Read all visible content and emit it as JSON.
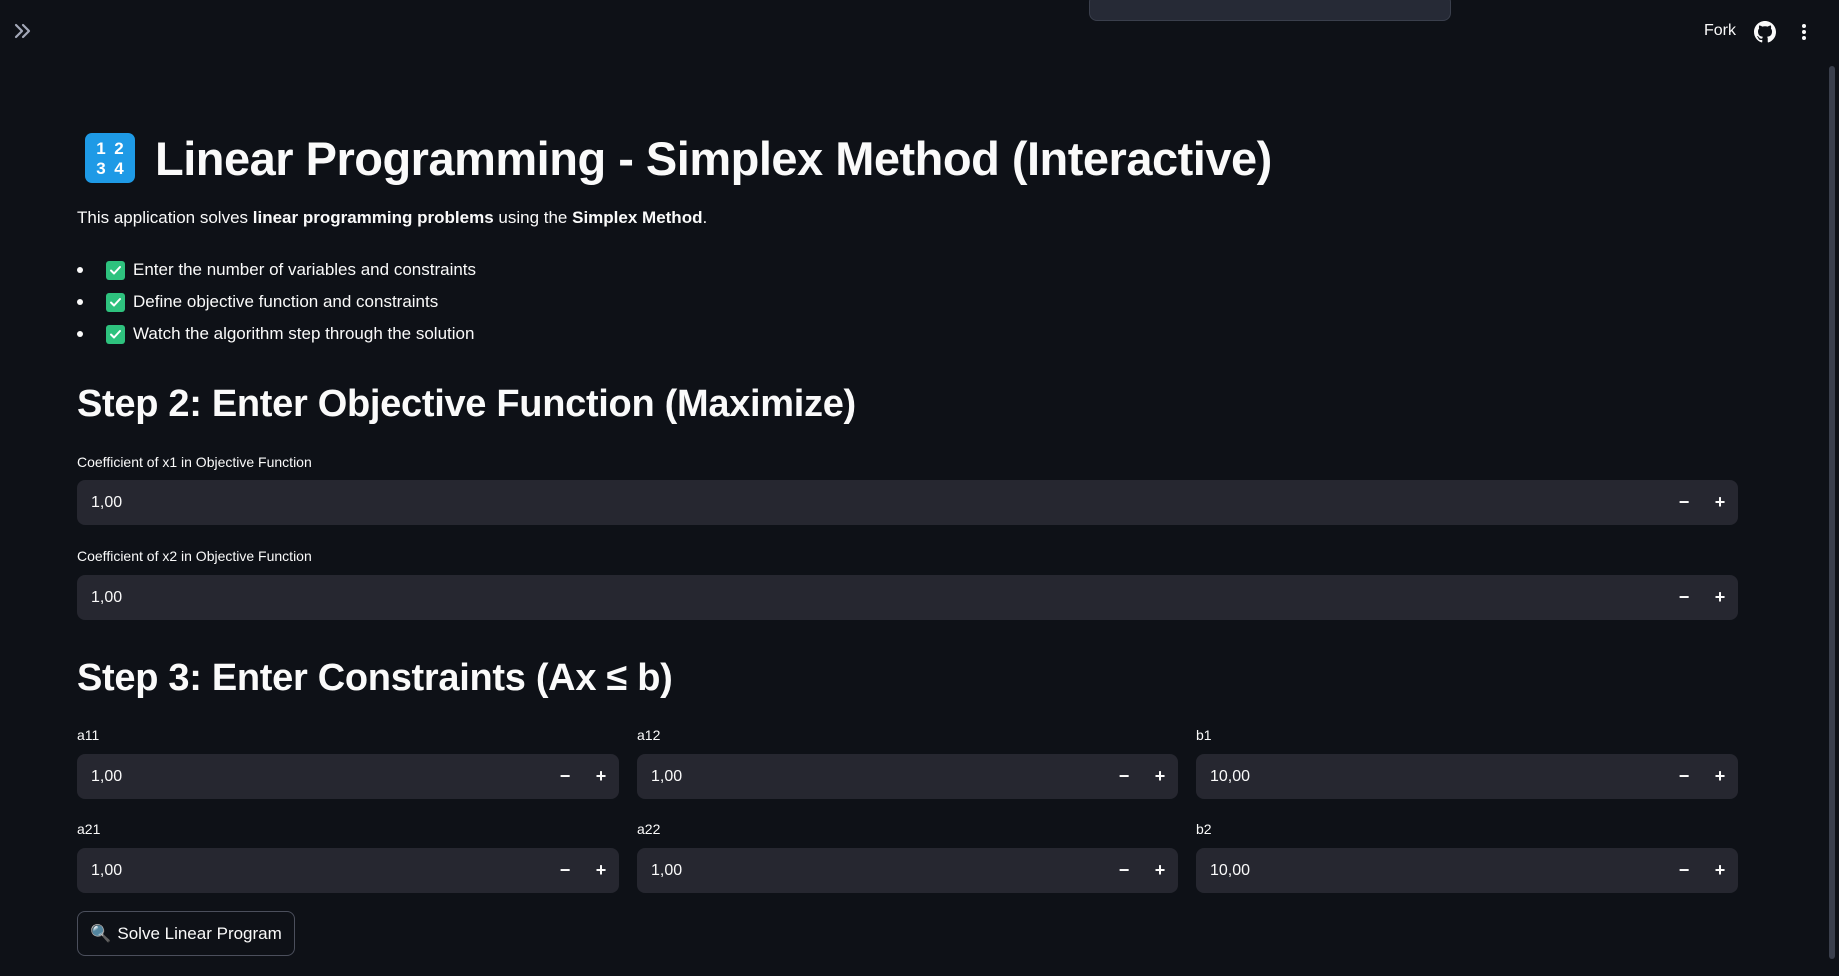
{
  "header": {
    "fork_label": "Fork",
    "icons": [
      "double-chevron-right-icon",
      "github-icon",
      "kebab-menu-icon"
    ]
  },
  "title": {
    "emoji_digits": [
      "1",
      "2",
      "3",
      "4"
    ],
    "text": "Linear Programming - Simplex Method (Interactive)"
  },
  "intro": {
    "prefix": "This application solves ",
    "bold1": "linear programming problems",
    "middle": " using the ",
    "bold2": "Simplex Method",
    "suffix": "."
  },
  "bullets": [
    "Enter the number of variables and constraints",
    "Define objective function and constraints",
    "Watch the algorithm step through the solution"
  ],
  "step2": {
    "heading": "Step 2: Enter Objective Function (Maximize)",
    "fields": [
      {
        "label": "Coefficient of x1 in Objective Function",
        "value": "1,00"
      },
      {
        "label": "Coefficient of x2 in Objective Function",
        "value": "1,00"
      }
    ]
  },
  "step3": {
    "heading": "Step 3: Enter Constraints (Ax ≤ b)",
    "rows": [
      [
        {
          "label": "a11",
          "value": "1,00"
        },
        {
          "label": "a12",
          "value": "1,00"
        },
        {
          "label": "b1",
          "value": "10,00"
        }
      ],
      [
        {
          "label": "a21",
          "value": "1,00"
        },
        {
          "label": "a22",
          "value": "1,00"
        },
        {
          "label": "b2",
          "value": "10,00"
        }
      ]
    ]
  },
  "stepper": {
    "minus": "−",
    "plus": "+"
  },
  "solve_button": {
    "icon": "🔍",
    "label": "Solve Linear Program"
  },
  "colors": {
    "background": "#0e1117",
    "input_background": "#262730",
    "check_green": "#2ec27e",
    "emoji_blue": "#1e9ae6"
  }
}
